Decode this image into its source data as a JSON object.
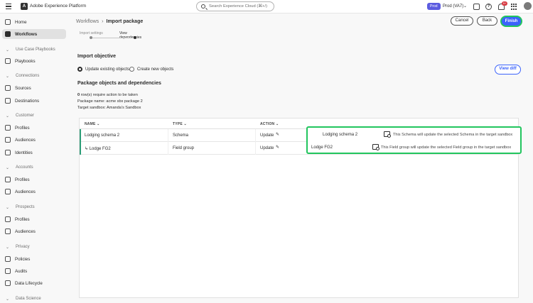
{
  "app": {
    "name": "Adobe Experience Platform"
  },
  "search": {
    "placeholder": "Search Experience Cloud (⌘+/)"
  },
  "environment": {
    "badge": "Prod",
    "name": "Prod (VA7)"
  },
  "notifications": {
    "count": "9+"
  },
  "sidebar": {
    "items": [
      {
        "label": "Home",
        "icon": "home-icon",
        "active": false
      },
      {
        "label": "Workflows",
        "icon": "workflows-icon",
        "active": true
      },
      {
        "section": "Use Case Playbooks"
      },
      {
        "label": "Playbooks",
        "icon": "playbooks-icon"
      },
      {
        "section": "Connections"
      },
      {
        "label": "Sources",
        "icon": "sources-icon"
      },
      {
        "label": "Destinations",
        "icon": "destinations-icon"
      },
      {
        "section": "Customer"
      },
      {
        "label": "Profiles",
        "icon": "profiles-icon"
      },
      {
        "label": "Audiences",
        "icon": "audiences-icon"
      },
      {
        "label": "Identities",
        "icon": "identities-icon"
      },
      {
        "section": "Accounts"
      },
      {
        "label": "Profiles",
        "icon": "profiles-icon"
      },
      {
        "label": "Audiences",
        "icon": "audiences-icon"
      },
      {
        "section": "Prospects"
      },
      {
        "label": "Profiles",
        "icon": "profiles-icon"
      },
      {
        "label": "Audiences",
        "icon": "audiences-icon"
      },
      {
        "section": "Privacy"
      },
      {
        "label": "Policies",
        "icon": "policies-icon"
      },
      {
        "label": "Audits",
        "icon": "audits-icon"
      },
      {
        "label": "Data Lifecycle",
        "icon": "data-lifecycle-icon"
      },
      {
        "section": "Data Science"
      }
    ]
  },
  "breadcrumb": {
    "parent": "Workflows",
    "current": "Import package"
  },
  "actions": {
    "cancel": "Cancel",
    "back": "Back",
    "finish": "Finish"
  },
  "stepper": {
    "steps": [
      "Import settings",
      "View dependencies"
    ],
    "current_step": 2
  },
  "objective": {
    "title": "Import objective",
    "options": [
      {
        "label": "Update existing objects",
        "checked": true
      },
      {
        "label": "Create new objects",
        "checked": false
      }
    ],
    "view_diff": "View diff"
  },
  "package": {
    "title": "Package objects and dependencies",
    "rows_count": "0",
    "rows_text": " row(s) require action to be taken",
    "package_name": "Package name: acme sbx package 2",
    "target_sandbox": "Target sandbox: Amanda's Sandbox"
  },
  "table": {
    "columns": [
      "NAME",
      "TYPE",
      "ACTION"
    ],
    "rows": [
      {
        "name": "Lodging schema 2",
        "type": "Schema",
        "action": "Update"
      },
      {
        "name": "↳ Lodge FG2",
        "type": "Field group",
        "action": "Update"
      }
    ]
  },
  "callout": {
    "rows": [
      {
        "name": "Lodging schema 2",
        "description": "This Schema will update the selected Schema in the target sandbox"
      },
      {
        "name": "Lodge FG2",
        "description": "This Field group will update the selected Field group in the target sandbox"
      }
    ]
  }
}
